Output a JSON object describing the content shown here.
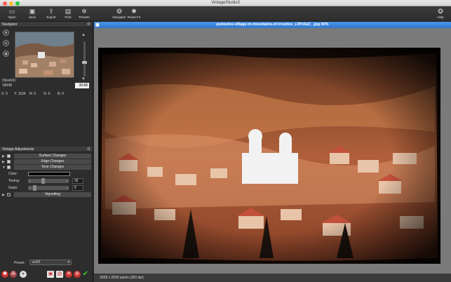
{
  "window": {
    "title": "VintageStudio3"
  },
  "toolbar": {
    "open": "Open",
    "save": "Save",
    "export": "Export",
    "print": "Print",
    "presets": "Presets",
    "navigator": "Navigator",
    "reset_fit": "Reset Fit",
    "help": "Help"
  },
  "navigator": {
    "header": "Navigator",
    "size_label": "(Size64):",
    "size_value": "18048",
    "zoom": "39.88",
    "coords": {
      "x": "X: 0",
      "y": "Y: 1104",
      "r": "R: 0",
      "g": "G: 0",
      "b": "B: 0"
    }
  },
  "adjustments": {
    "header": "Vintage Adjustments",
    "groups": [
      "Surface Changes",
      "Edge Changes",
      "Tone Changes"
    ],
    "color_label": "Color:",
    "color_value": "#000000",
    "toning_label": "Toning:",
    "toning_value": "32",
    "toning_level": 0.32,
    "grain_label": "Grain:",
    "grain_value": "5",
    "grain_level": 0.05,
    "vignetting": "Vignetting"
  },
  "preset": {
    "label": "Preset:",
    "value": "sci01"
  },
  "document": {
    "title": "pedoules-village-in-mountains-of-troodos_zJPx5qC_.jpg 40%",
    "status": "3008 x 2000 pixels (300 dpi)"
  },
  "colors": {
    "accent": "#2f78cf",
    "close": "#ff5f57",
    "minimize": "#febc2e",
    "maximize": "#28c840"
  }
}
